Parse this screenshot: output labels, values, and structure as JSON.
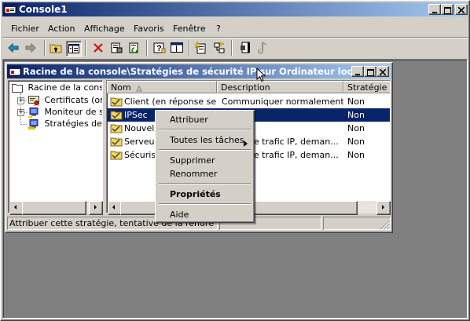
{
  "app_window": {
    "title": "Console1",
    "controls": [
      "minimize",
      "maximize",
      "close"
    ]
  },
  "menubar": {
    "items": [
      "Fichier",
      "Action",
      "Affichage",
      "Favoris",
      "Fenêtre",
      "?"
    ]
  },
  "toolbar": {
    "icons": [
      "back-icon",
      "forward-icon",
      "up-folder-icon",
      "show-tree-icon",
      "delete-icon",
      "properties-icon",
      "refresh-icon",
      "help-icon",
      "console-icon",
      "new-policy-icon",
      "manage-filters-icon",
      "assign-icon",
      "unassign-icon"
    ]
  },
  "child_window": {
    "title": "Racine de la console\\Stratégies de sécurité IP sur Ordinateur local",
    "tree": {
      "items": [
        {
          "label": "Racine de la console",
          "icon": "folder-icon"
        },
        {
          "label": "Certificats (ordi",
          "icon": "certificate-icon",
          "expander": "+"
        },
        {
          "label": "Moniteur de séc",
          "icon": "monitor-icon",
          "expander": "+"
        },
        {
          "label": "Stratégies de se",
          "icon": "ipsec-policy-icon"
        }
      ]
    },
    "list": {
      "columns": [
        "Nom",
        "Description",
        "Stratégie a"
      ],
      "rows": [
        {
          "name": "Client (en réponse se...",
          "description": "Communiquer normalement ...",
          "assigned": "Non",
          "selected": false
        },
        {
          "name": "IPSec",
          "description": "",
          "assigned": "Non",
          "selected": true
        },
        {
          "name": "Nouvelle",
          "description": "",
          "assigned": "Non",
          "selected": false
        },
        {
          "name": "Serveur",
          "description": "t le trafic IP, deman...",
          "assigned": "Non",
          "selected": false
        },
        {
          "name": "Sécurise",
          "description": "t le trafic IP, deman...",
          "assigned": "Non",
          "selected": false
        }
      ]
    },
    "status": "Attribuer cette stratégie, tentative de la rendre active"
  },
  "context_menu": {
    "items": {
      "assign": "Attribuer",
      "all_tasks": "Toutes les tâches",
      "delete": "Supprimer",
      "rename": "Renommer",
      "properties": "Propriétés",
      "help": "Aide"
    }
  },
  "colors": {
    "title_active_start": "#0a246a",
    "title_active_end": "#a6caf0",
    "face": "#d4d0c8",
    "selection": "#0a246a",
    "desktop": "#808080"
  }
}
